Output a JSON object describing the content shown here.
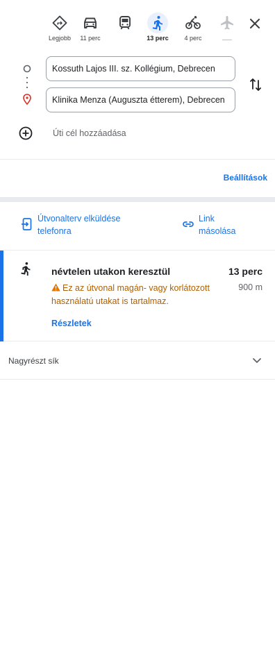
{
  "travel_modes": [
    {
      "name": "best",
      "label": "Legjobb",
      "icon": "directions-icon"
    },
    {
      "name": "car",
      "label": "11 perc",
      "icon": "car-icon"
    },
    {
      "name": "transit",
      "label": "",
      "icon": "train-icon"
    },
    {
      "name": "walk",
      "label": "13 perc",
      "icon": "walk-icon",
      "active": true
    },
    {
      "name": "bike",
      "label": "4 perc",
      "icon": "bike-icon"
    },
    {
      "name": "flight",
      "label": "",
      "icon": "flight-icon",
      "disabled": true
    }
  ],
  "route": {
    "start": "Kossuth Lajos III. sz. Kollégium, Debrecen",
    "destination": "Klinika Menza (Auguszta étterem), Debrecen",
    "add_destination": "Úti cél hozzáadása"
  },
  "settings_label": "Beállítások",
  "share": {
    "send_to_phone": "Útvonalterv elküldése telefonra",
    "copy_link": "Link másolása"
  },
  "route_option": {
    "title": "névtelen utakon keresztül",
    "duration": "13 perc",
    "distance": "900 m",
    "warning": "Ez az útvonal magán- vagy korlátozott használatú utakat is tartalmaz.",
    "details": "Részletek"
  },
  "terrain": "Nagyrészt sík",
  "colors": {
    "accent": "#1a73e8",
    "warning": "#b06000",
    "active_mode_bg": "#e8f0fe"
  }
}
